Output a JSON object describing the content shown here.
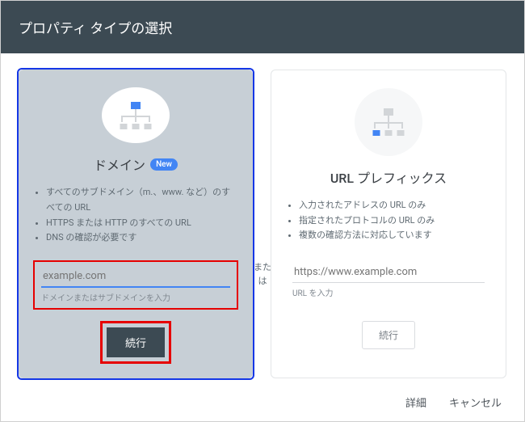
{
  "header": {
    "title": "プロパティ タイプの選択"
  },
  "middle_text": "または",
  "card_domain": {
    "title": "ドメイン",
    "badge": "New",
    "bullets": [
      "すべてのサブドメイン（m.、www. など）のすべての URL",
      "HTTPS または HTTP のすべての URL",
      "DNS の確認が必要です"
    ],
    "input_placeholder": "example.com",
    "input_label": "ドメインまたはサブドメインを入力",
    "button": "続行"
  },
  "card_url": {
    "title": "URL プレフィックス",
    "bullets": [
      "入力されたアドレスの URL のみ",
      "指定されたプロトコルの URL のみ",
      "複数の確認方法に対応しています"
    ],
    "input_placeholder": "https://www.example.com",
    "input_label": "URL を入力",
    "button": "続行"
  },
  "footer": {
    "details": "詳細",
    "cancel": "キャンセル"
  }
}
